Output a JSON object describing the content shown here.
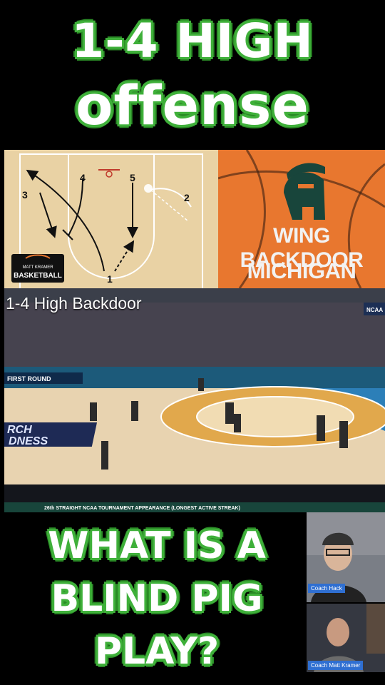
{
  "header": {
    "line1": "1-4 HIGH",
    "line2": "offense"
  },
  "diagram": {
    "players": [
      "3",
      "4",
      "5",
      "2",
      "1"
    ],
    "logo_text": [
      "MATT KRAMER",
      "BASKETBALL"
    ]
  },
  "msu": {
    "line1": "WING BACKDOOR",
    "line2": "MICHIGAN STATE"
  },
  "video": {
    "title": "1-4 High Backdoor",
    "banner_left": "FIRST ROUND",
    "floor_text": "RCH\nDNESS",
    "ticker": "26th STRAIGHT NCAA TOURNAMENT APPEARANCE (LONGEST ACTIVE STREAK)",
    "corner_logo": "NCAA"
  },
  "bottom": {
    "line1": "WHAT IS A",
    "line2": "BLIND PIG",
    "line3": "PLAY?"
  },
  "webcams": [
    {
      "label": "Coach Hack"
    },
    {
      "label": "Coach Matt Kramer"
    }
  ],
  "colors": {
    "accent_green": "#3fb03a",
    "msu_green": "#18453b",
    "msu_orange": "#e8772f"
  }
}
